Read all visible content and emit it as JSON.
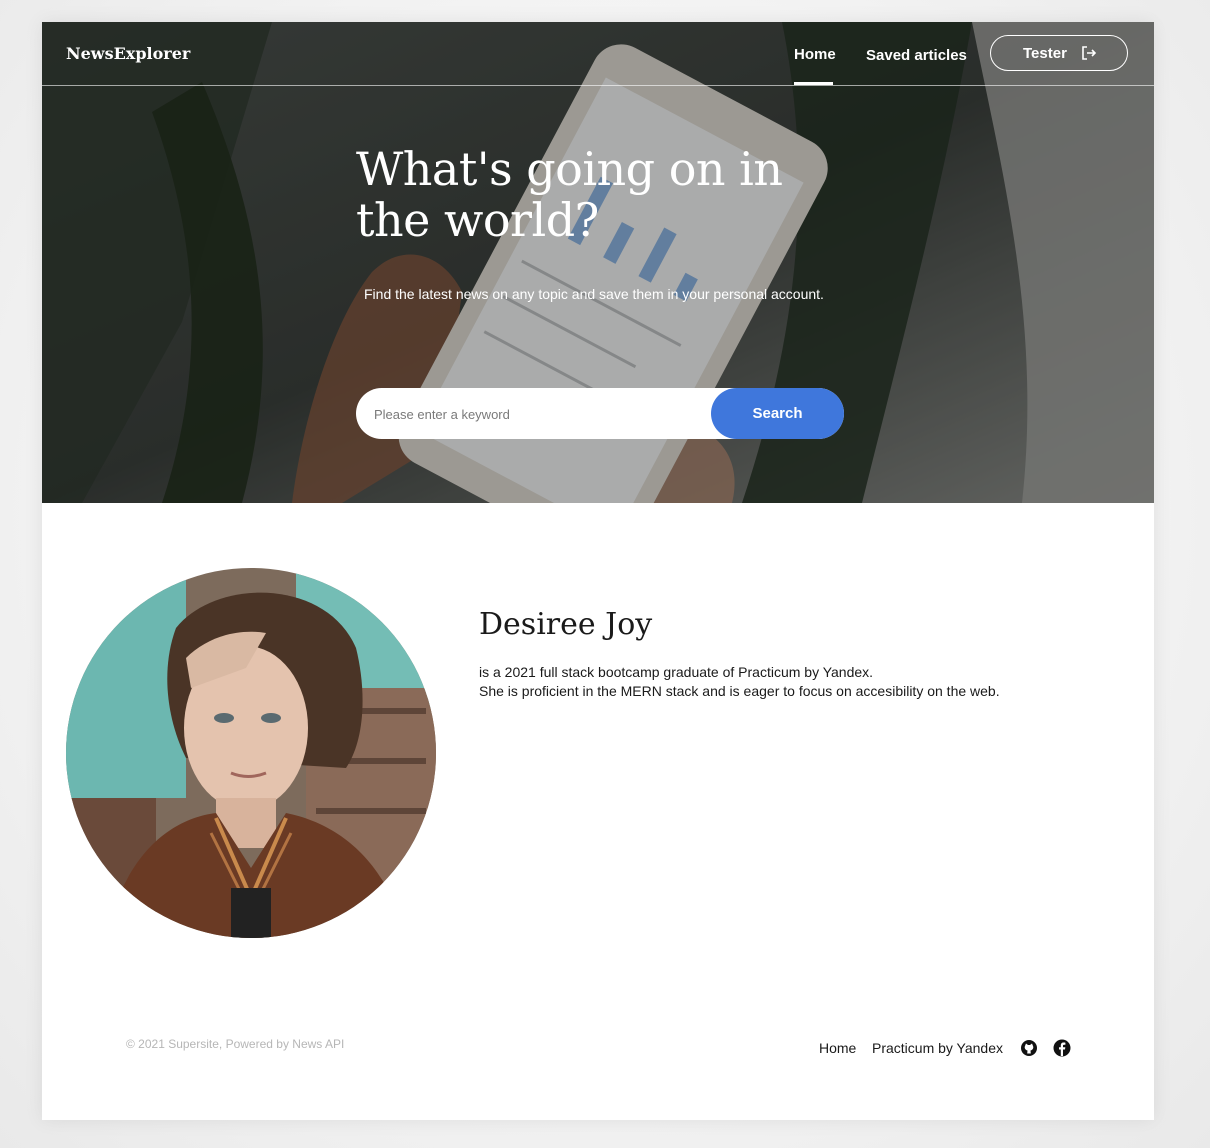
{
  "header": {
    "logo": "NewsExplorer",
    "nav": {
      "home": "Home",
      "saved": "Saved articles"
    },
    "user": {
      "name": "Tester",
      "logout_icon": "logout-icon"
    }
  },
  "hero": {
    "title": "What's going on in the world?",
    "subtitle": "Find the latest news on any topic and save them in your personal account.",
    "search": {
      "placeholder": "Please enter a keyword",
      "value": "",
      "button": "Search"
    }
  },
  "about": {
    "name": "Desiree Joy",
    "line1": "is a 2021 full stack bootcamp graduate of Practicum by Yandex.",
    "line2": "She is proficient in the MERN stack and is eager to focus on accesibility on the web."
  },
  "footer": {
    "copyright": "© 2021 Supersite, Powered by News API",
    "links": {
      "home": "Home",
      "practicum": "Practicum by Yandex"
    },
    "icons": [
      "github-icon",
      "facebook-icon"
    ]
  },
  "colors": {
    "accent": "#3f77dc",
    "text": "#1a1a1a",
    "muted": "#b6b6b6"
  }
}
